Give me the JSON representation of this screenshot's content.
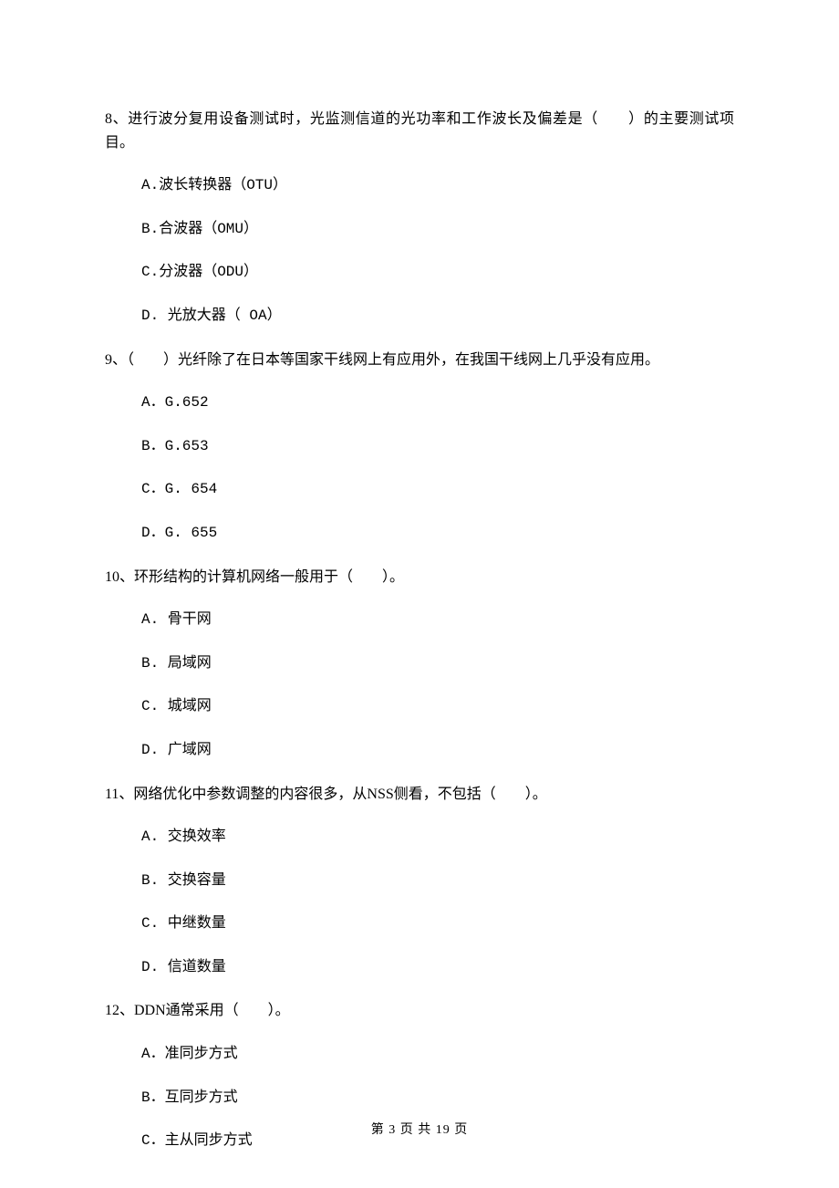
{
  "q8": {
    "stem": "8、进行波分复用设备测试时，光监测信道的光功率和工作波长及偏差是（　　）的主要测试项目。",
    "a": "A.波长转换器（OTU）",
    "b": "B.合波器（OMU）",
    "c": "C.分波器（ODU）",
    "d": "D. 光放大器（ OA）"
  },
  "q9": {
    "stem": "9、（　　）光纤除了在日本等国家干线网上有应用外，在我国干线网上几乎没有应用。",
    "a": "A．G.652",
    "b": "B．G.653",
    "c": "C．G. 654",
    "d": "D．G. 655"
  },
  "q10": {
    "stem": "10、环形结构的计算机网络一般用于（　　）。",
    "a": "A. 骨干网",
    "b": "B. 局域网",
    "c": "C. 城域网",
    "d": "D. 广域网"
  },
  "q11": {
    "stem": "11、网络优化中参数调整的内容很多，从NSS侧看，不包括（　　）。",
    "a": "A. 交换效率",
    "b": "B. 交换容量",
    "c": "C. 中继数量",
    "d": "D. 信道数量"
  },
  "q12": {
    "stem": "12、DDN通常采用（　　）。",
    "a": "A．准同步方式",
    "b": "B．互同步方式",
    "c": "C．主从同步方式"
  },
  "footer": "第 3 页 共 19 页"
}
